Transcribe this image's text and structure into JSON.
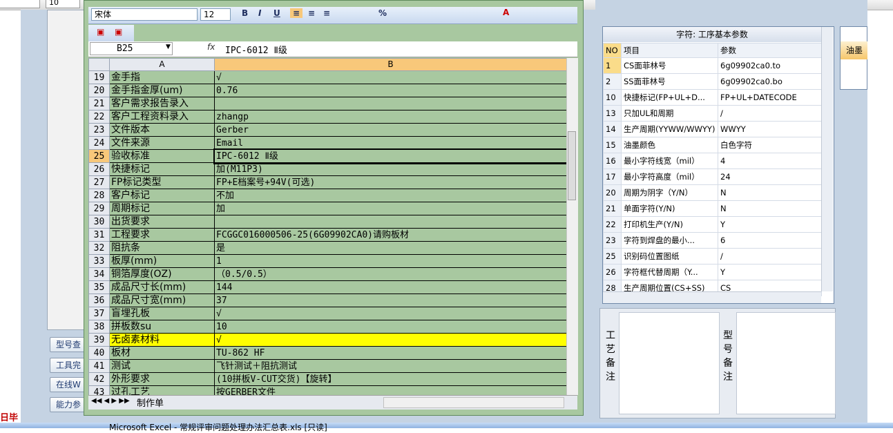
{
  "host_toolbar": {
    "font_size": "10",
    "font_color_btn": "A",
    "bold": "B",
    "italic": "I",
    "underline": "U"
  },
  "left_buttons": [
    "型号查",
    "工具完",
    "在线W",
    "能力参"
  ],
  "left_edge_text": "日毕",
  "excel": {
    "font_name": "宋体",
    "font_size": "12",
    "bold": "B",
    "italic": "I",
    "underline": "U",
    "percent": "%",
    "name_box": "B25",
    "fx": "fx",
    "formula": "IPC-6012 Ⅱ级",
    "col_a": "A",
    "col_b": "B",
    "sheet_tab": "制作单",
    "rows": [
      {
        "n": "19",
        "a": "金手指",
        "b": "√"
      },
      {
        "n": "20",
        "a": "金手指金厚(um)",
        "b": "0.76"
      },
      {
        "n": "21",
        "a": "客户需求报告录入",
        "b": ""
      },
      {
        "n": "22",
        "a": "客户工程资料录入",
        "b": "zhangp"
      },
      {
        "n": "23",
        "a": "文件版本",
        "b": "Gerber"
      },
      {
        "n": "24",
        "a": "文件来源",
        "b": "Email"
      },
      {
        "n": "25",
        "a": "验收标准",
        "b": "IPC-6012 Ⅱ级"
      },
      {
        "n": "26",
        "a": "快捷标记",
        "b": "加(M11P3)"
      },
      {
        "n": "27",
        "a": "FP标记类型",
        "b": "FP+E档案号+94V(可选)"
      },
      {
        "n": "28",
        "a": "客户标记",
        "b": "不加"
      },
      {
        "n": "29",
        "a": "周期标记",
        "b": "加"
      },
      {
        "n": "30",
        "a": "出货要求",
        "b": ""
      },
      {
        "n": "31",
        "a": "工程要求",
        "b": "FCGGC016000506-25(6G09902CA0)请购板材"
      },
      {
        "n": "32",
        "a": "阻抗条",
        "b": "是"
      },
      {
        "n": "33",
        "a": "板厚(mm)",
        "b": "1"
      },
      {
        "n": "34",
        "a": "铜箔厚度(OZ)",
        "b": "（0.5/0.5）"
      },
      {
        "n": "35",
        "a": "成品尺寸长(mm)",
        "b": "144"
      },
      {
        "n": "36",
        "a": "成品尺寸宽(mm)",
        "b": "37"
      },
      {
        "n": "37",
        "a": "盲埋孔板",
        "b": "√"
      },
      {
        "n": "38",
        "a": "拼板数su",
        "b": "10"
      },
      {
        "n": "39",
        "a": "无卤素材料",
        "b": "√"
      },
      {
        "n": "40",
        "a": "板材",
        "b": "TU-862 HF"
      },
      {
        "n": "41",
        "a": "测试",
        "b": "飞针测试＋阻抗测试"
      },
      {
        "n": "42",
        "a": "外形要求",
        "b": "(10拼板V-CUT交货)【旋转】"
      },
      {
        "n": "43",
        "a": "过孔工艺",
        "b": "按GERBER文件"
      }
    ]
  },
  "params": {
    "title": "字符: 工序基本参数",
    "headers": {
      "no": "NO",
      "item": "项目",
      "value": "参数"
    },
    "rows": [
      {
        "no": "1",
        "item": "CS面菲林号",
        "value": "6g09902ca0.to"
      },
      {
        "no": "2",
        "item": "SS面菲林号",
        "value": "6g09902ca0.bo"
      },
      {
        "no": "10",
        "item": "快捷标记(FP+UL+D...",
        "value": "FP+UL+DATECODE"
      },
      {
        "no": "13",
        "item": "只加UL和周期",
        "value": "/"
      },
      {
        "no": "14",
        "item": "生产周期(YYWW/WWYY)",
        "value": "WWYY"
      },
      {
        "no": "15",
        "item": "油墨颜色",
        "value": "白色字符"
      },
      {
        "no": "16",
        "item": "最小字符线宽（mil）",
        "value": "4"
      },
      {
        "no": "17",
        "item": "最小字符高度（mil）",
        "value": "24"
      },
      {
        "no": "20",
        "item": "周期为阴字（Y/N）",
        "value": "N"
      },
      {
        "no": "21",
        "item": "单面字符(Y/N)",
        "value": "N"
      },
      {
        "no": "22",
        "item": "打印机生产(Y/N)",
        "value": "Y"
      },
      {
        "no": "23",
        "item": "字符到焊盘的最小...",
        "value": "6"
      },
      {
        "no": "25",
        "item": "识别码位置图纸",
        "value": "/"
      },
      {
        "no": "26",
        "item": "字符框代替周期（Y...",
        "value": "Y"
      },
      {
        "no": "28",
        "item": "生产周期位置(CS+SS)",
        "value": "CS"
      }
    ]
  },
  "mini_panel_header": "油墨",
  "notes": {
    "craft_label": "工艺备注",
    "model_label": "型号备注"
  },
  "taskbar_text": "Microsoft Excel - 常规评审问题处理办法汇总表.xls [只读]"
}
